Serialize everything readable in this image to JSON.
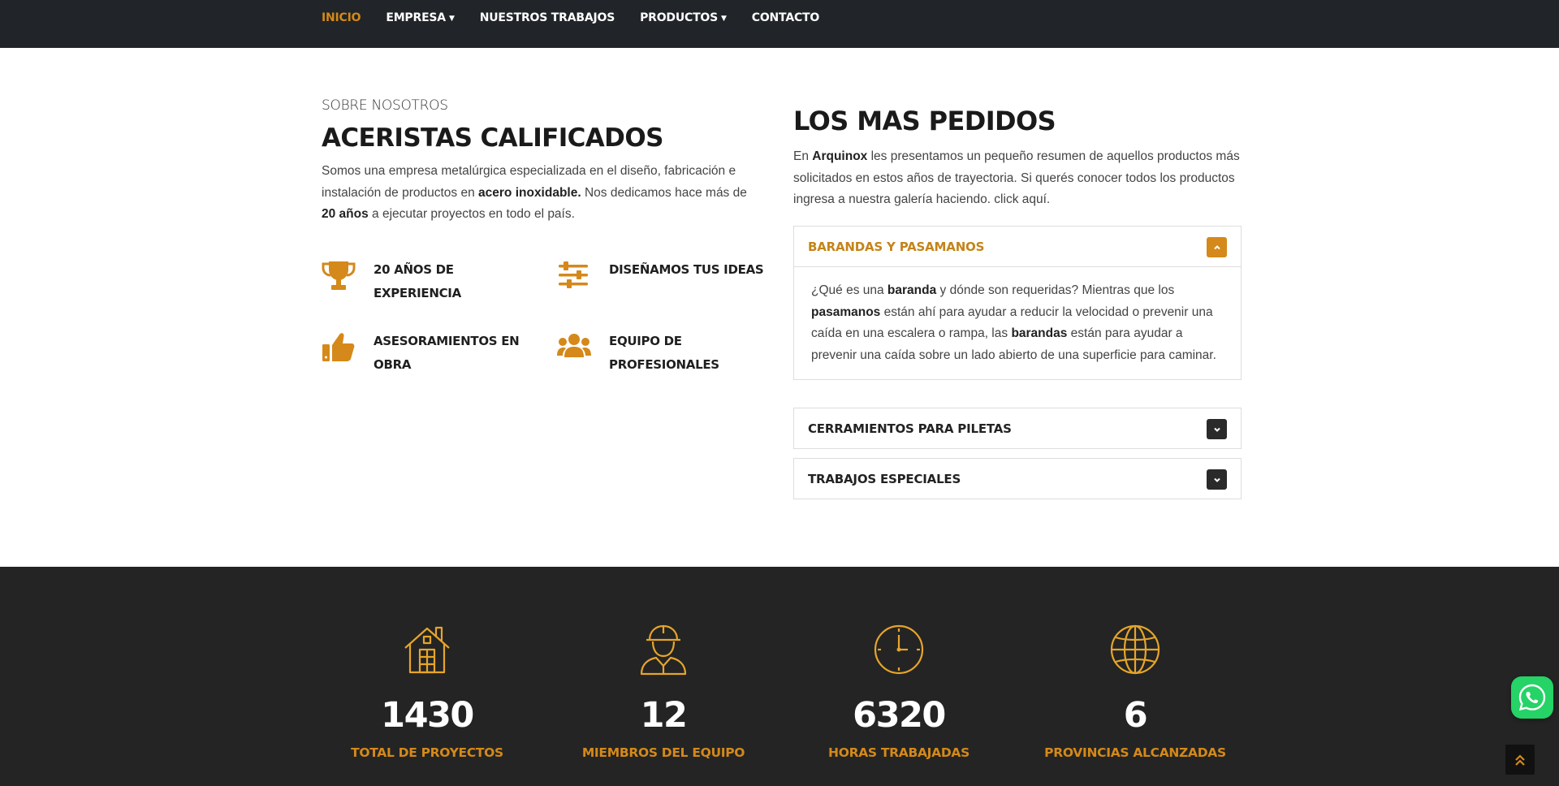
{
  "nav": {
    "items": [
      {
        "label": "INICIO",
        "active": true,
        "dropdown": false
      },
      {
        "label": "EMPRESA",
        "active": false,
        "dropdown": true
      },
      {
        "label": "NUESTROS TRABAJOS",
        "active": false,
        "dropdown": false
      },
      {
        "label": "PRODUCTOS",
        "active": false,
        "dropdown": true
      },
      {
        "label": "CONTACTO",
        "active": false,
        "dropdown": false
      }
    ]
  },
  "about": {
    "eyebrow": "SOBRE NOSOTROS",
    "title": "ACERISTAS CALIFICADOS",
    "lead_part1": "Somos una empresa metalúrgica especializada en el diseño, fabricación e instalación de productos en ",
    "lead_bold1": "acero inoxidable.",
    "lead_part2": " Nos dedicamos hace más de ",
    "lead_bold2": "20 años",
    "lead_part3": " a ejecutar proyectos en todo el país.",
    "features": [
      {
        "icon": "trophy-icon",
        "line1": "20 AÑOS DE",
        "line2": "EXPERIENCIA"
      },
      {
        "icon": "sliders-icon",
        "line1": "DISEÑAMOS TUS IDEAS",
        "line2": ""
      },
      {
        "icon": "thumbs-up-icon",
        "line1": "ASESORAMIENTOS EN",
        "line2": "OBRA"
      },
      {
        "icon": "users-icon",
        "line1": "EQUIPO DE",
        "line2": "PROFESIONALES"
      }
    ]
  },
  "popular": {
    "title": "LOS MAS PEDIDOS",
    "lead_part1": "En ",
    "lead_bold": "Arquinox",
    "lead_part2": " les presentamos un pequeño resumen de aquellos productos más solicitados en estos años de trayectoria. Si querés conocer todos los productos ingresa a nuestra galería haciendo. click aquí.",
    "accordion": [
      {
        "title": "BARANDAS Y PASAMANOS",
        "open": true,
        "body": {
          "p1": "¿Qué es una ",
          "b1": "baranda",
          "p2": " y dónde son requeridas? Mientras que los ",
          "b2": "pasamanos",
          "p3": " están ahí para ayudar a reducir la velocidad o prevenir una caída en una escalera o rampa, las ",
          "b3": "barandas",
          "p4": " están para ayudar a prevenir una caída sobre un lado abierto de una superficie para caminar."
        }
      },
      {
        "title": "CERRAMIENTOS PARA PILETAS",
        "open": false
      },
      {
        "title": "TRABAJOS ESPECIALES",
        "open": false
      }
    ]
  },
  "stats": [
    {
      "icon": "house-icon",
      "value": "1430",
      "label": "TOTAL DE PROYECTOS"
    },
    {
      "icon": "worker-icon",
      "value": "12",
      "label": "MIEMBROS DEL EQUIPO"
    },
    {
      "icon": "clock-icon",
      "value": "6320",
      "label": "HORAS TRABAJADAS"
    },
    {
      "icon": "globe-icon",
      "value": "6",
      "label": "PROVINCIAS ALCANZADAS"
    }
  ],
  "colors": {
    "accent": "#d4891a",
    "nav_bg": "#212529",
    "stats_bg": "#242424",
    "whatsapp": "#25d366"
  },
  "floating": {
    "whatsapp_icon": "whatsapp-icon",
    "scroll_top_icon": "double-chevron-up-icon"
  }
}
